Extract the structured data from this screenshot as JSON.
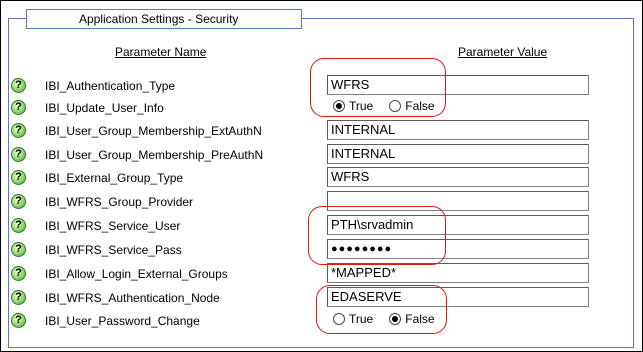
{
  "section_title": "Application Settings - Security",
  "headers": {
    "name": "Parameter Name",
    "value": "Parameter Value"
  },
  "help_glyph": "?",
  "rows": [
    {
      "name": "IBI_Authentication_Type",
      "type": "text",
      "value": "WFRS"
    },
    {
      "name": "IBI_Update_User_Info",
      "type": "radio",
      "options": [
        "True",
        "False"
      ],
      "selected": "True"
    },
    {
      "name": "IBI_User_Group_Membership_ExtAuthN",
      "type": "text",
      "value": "INTERNAL"
    },
    {
      "name": "IBI_User_Group_Membership_PreAuthN",
      "type": "text",
      "value": "INTERNAL"
    },
    {
      "name": "IBI_External_Group_Type",
      "type": "text",
      "value": "WFRS"
    },
    {
      "name": "IBI_WFRS_Group_Provider",
      "type": "text",
      "value": ""
    },
    {
      "name": "IBI_WFRS_Service_User",
      "type": "text",
      "value": "PTH\\srvadmin"
    },
    {
      "name": "IBI_WFRS_Service_Pass",
      "type": "password",
      "value": "●●●●●●●●"
    },
    {
      "name": "IBI_Allow_Login_External_Groups",
      "type": "text",
      "value": "*MAPPED*"
    },
    {
      "name": "IBI_WFRS_Authentication_Node",
      "type": "text",
      "value": "EDASERVE"
    },
    {
      "name": "IBI_User_Password_Change",
      "type": "radio",
      "options": [
        "True",
        "False"
      ],
      "selected": "False"
    }
  ],
  "highlight_color": "#e01818"
}
